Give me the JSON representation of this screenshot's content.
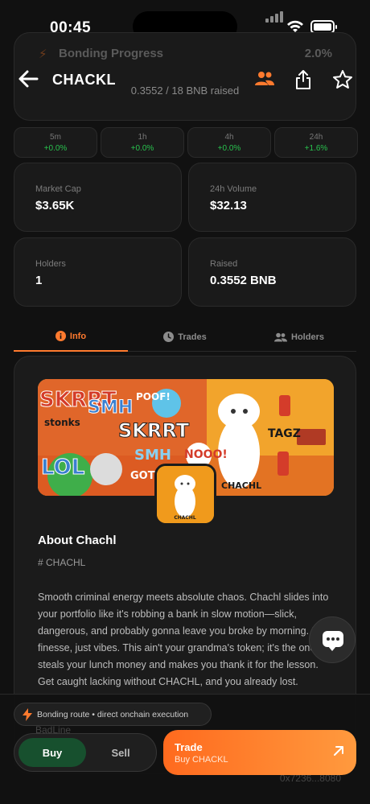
{
  "status_bar": {
    "time": "00:45"
  },
  "bonding": {
    "label": "Bonding Progress",
    "percent_text": "2.0%",
    "raised_text": "0.3552 / 18 BNB raised"
  },
  "header": {
    "title": "CHACKL"
  },
  "timeframes": [
    {
      "label": "5m",
      "value": "+0.0%"
    },
    {
      "label": "1h",
      "value": "+0.0%"
    },
    {
      "label": "4h",
      "value": "+0.0%"
    },
    {
      "label": "24h",
      "value": "+1.6%"
    }
  ],
  "stats": [
    {
      "label": "Market Cap",
      "value": "$3.65K"
    },
    {
      "label": "24h Volume",
      "value": "$32.13"
    },
    {
      "label": "Holders",
      "value": "1"
    },
    {
      "label": "Raised",
      "value": "0.3552 BNB"
    }
  ],
  "tabs": [
    {
      "label": "Info",
      "icon": "info-icon",
      "active": true
    },
    {
      "label": "Trades",
      "icon": "clock-icon",
      "active": false
    },
    {
      "label": "Holders",
      "icon": "users-icon",
      "active": false
    }
  ],
  "about": {
    "title": "About Chachl",
    "tag": "# CHACHL",
    "description": "Smooth criminal energy meets absolute chaos. Chachl slides into your portfolio like it's robbing a bank in slow motion—slick, dangerous, and probably gonna leave you broke by morning. No finesse, just vibes. This ain't your grandma's token; it's the one that steals your lunch money and makes you thank it for the lesson. Get caught lacking without CHACHL, and you already lost."
  },
  "banner": {
    "graffiti": [
      "SKRRT",
      "SMH",
      "POOF!",
      "stonks",
      "SKRRT",
      "SMH",
      "LOL",
      "GOTTEM",
      "NOOO!",
      "TAGZ",
      "CHACHL"
    ],
    "avatar_label": "CHACHL"
  },
  "bottom": {
    "route_text": "Bonding route • direct onchain execution",
    "ghost_left": "BadLine",
    "ghost_right": "0x7236...8080",
    "buy_label": "Buy",
    "sell_label": "Sell",
    "trade_title": "Trade",
    "trade_sub": "Buy CHACKL"
  },
  "colors": {
    "accent": "#ff7a2e",
    "positive": "#29c24e",
    "buy_green": "#17502e",
    "background": "#111111"
  }
}
